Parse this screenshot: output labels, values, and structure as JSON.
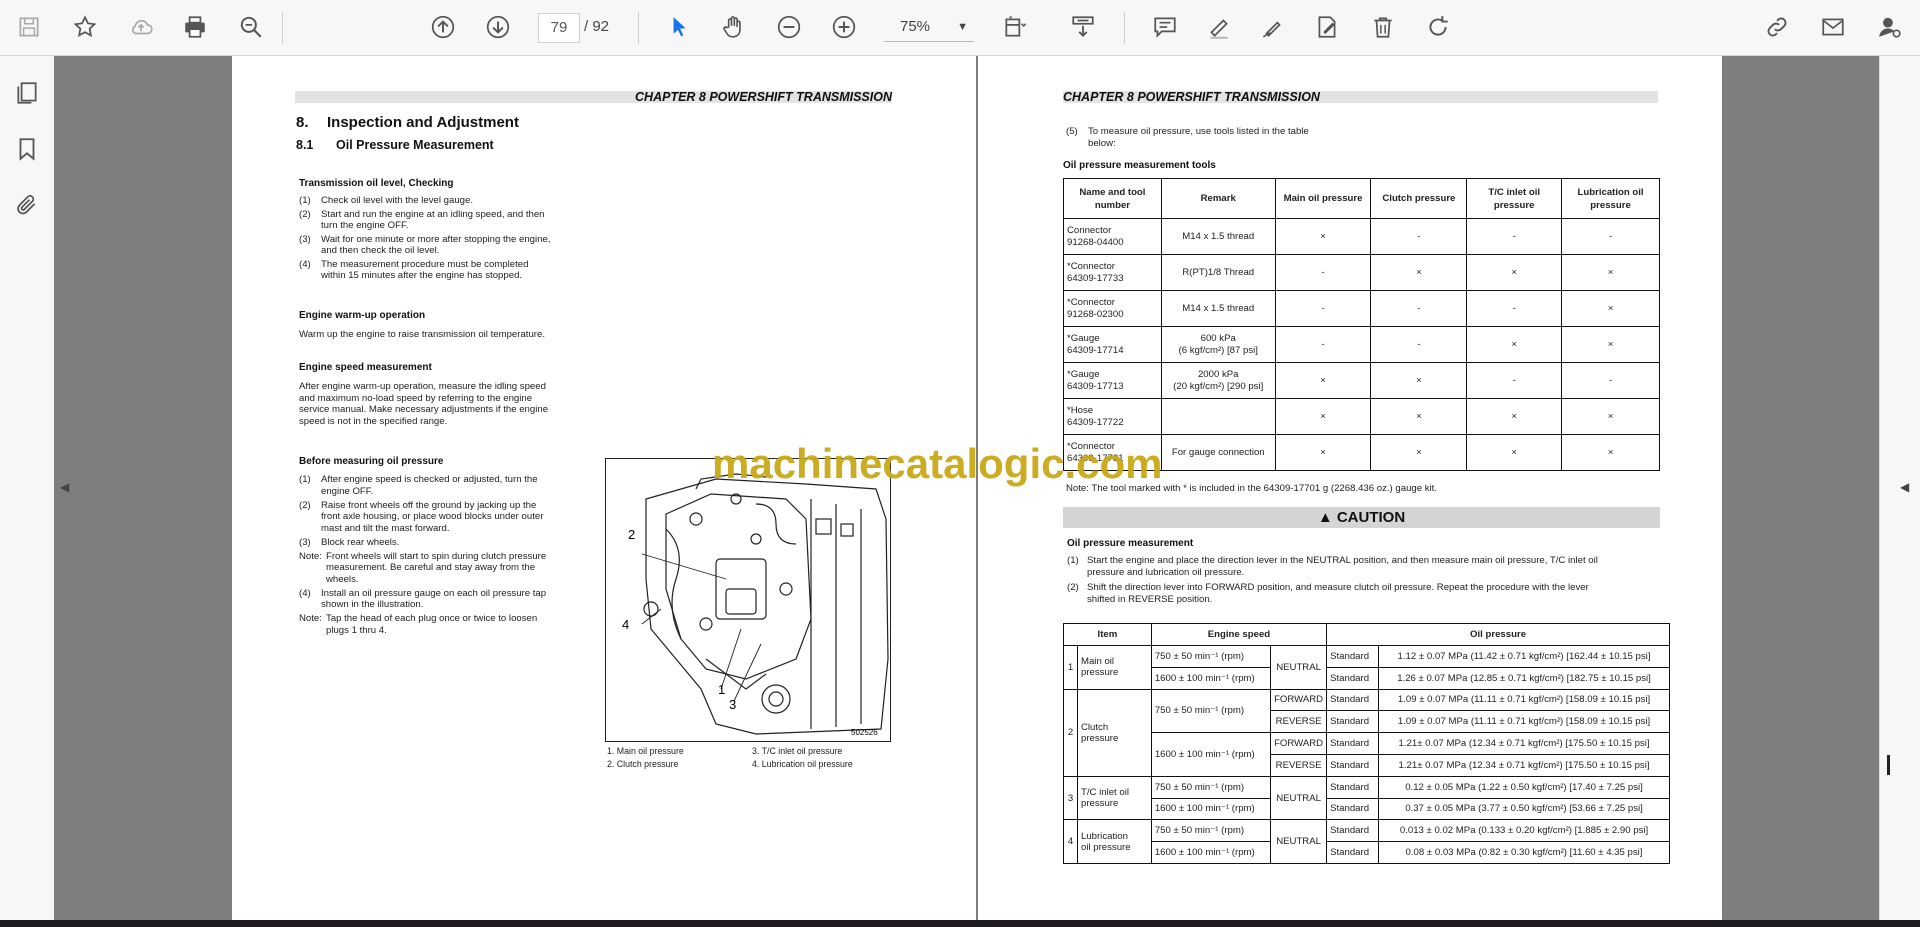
{
  "toolbar": {
    "page_current": "79",
    "page_total": "/  92",
    "zoom": "75%"
  },
  "left_page": {
    "chapter_header": "CHAPTER 8 POWERSHIFT TRANSMISSION",
    "section_number": "8.",
    "section_title": "Inspection and Adjustment",
    "subsection_number": "8.1",
    "subsection_title": "Oil Pressure Measurement",
    "oil_level_title": "Transmission oil level, Checking",
    "oil_level_items": [
      {
        "n": "(1)",
        "lines": [
          "Check oil level with the level gauge."
        ]
      },
      {
        "n": "(2)",
        "lines": [
          "Start and run the engine at an idling speed, and then",
          "turn the engine OFF."
        ]
      },
      {
        "n": "(3)",
        "lines": [
          "Wait for one minute or more after stopping the engine,",
          "and then check the oil level."
        ]
      },
      {
        "n": "(4)",
        "lines": [
          "The measurement procedure must be completed",
          "within 15 minutes after the engine has stopped."
        ]
      }
    ],
    "warmup_title": "Engine warm-up operation",
    "warmup_text": "Warm up the engine to raise transmission oil temperature.",
    "speed_title": "Engine speed measurement",
    "speed_lines": [
      "After engine warm-up operation, measure the idling speed",
      "and maximum no-load speed by referring to the engine",
      "service manual. Make necessary adjustments if the engine",
      "speed is not in the specified range."
    ],
    "before_title": "Before measuring oil pressure",
    "before_items": [
      {
        "n": "(1)",
        "lines": [
          "After engine speed is checked or adjusted, turn the",
          "engine OFF."
        ]
      },
      {
        "n": "(2)",
        "lines": [
          "Raise front wheels off the ground by jacking up the",
          "front axle housing, or place wood blocks under outer",
          "mast and tilt the mast forward."
        ]
      },
      {
        "n": "(3)",
        "lines": [
          "Block rear wheels."
        ]
      },
      {
        "n": "Note:",
        "lines": [
          "Front wheels will start to spin during clutch pressure",
          "measurement. Be careful and stay away from the",
          "wheels."
        ]
      },
      {
        "n": "(4)",
        "lines": [
          "Install an oil pressure gauge on each oil pressure tap",
          "shown in the illustration."
        ]
      },
      {
        "n": "Note:",
        "lines": [
          "Tap the head of each plug once or twice to loosen",
          "plugs 1 thru 4."
        ]
      }
    ],
    "figure_id": "502526",
    "figure_callouts": [
      "1",
      "2",
      "3",
      "4"
    ],
    "figure_captions": [
      "1.  Main oil pressure",
      "2.  Clutch pressure",
      "3.  T/C inlet oil pressure",
      "4.  Lubrication oil pressure"
    ]
  },
  "right_page": {
    "chapter_header": "CHAPTER 8 POWERSHIFT TRANSMISSION",
    "step5_n": "(5)",
    "step5_lines": [
      "To measure oil pressure, use tools listed in the table",
      "below:"
    ],
    "tools_title": "Oil pressure measurement tools",
    "tools_headers": [
      "Name and tool number",
      "Remark",
      "Main oil pressure",
      "Clutch pressure",
      "T/C inlet oil pressure",
      "Lubrication oil pressure"
    ],
    "tools_rows": [
      {
        "name": [
          "Connector",
          "91268-04400"
        ],
        "remark": [
          "M14 x 1.5 thread"
        ],
        "vals": [
          "×",
          "-",
          "-",
          "-"
        ]
      },
      {
        "name": [
          "*Connector",
          "64309-17733"
        ],
        "remark": [
          "R(PT)1/8 Thread"
        ],
        "vals": [
          "-",
          "×",
          "×",
          "×"
        ]
      },
      {
        "name": [
          "*Connector",
          "91268-02300"
        ],
        "remark": [
          "M14 x 1.5 thread"
        ],
        "vals": [
          "-",
          "-",
          "-",
          "×"
        ]
      },
      {
        "name": [
          "*Gauge",
          "64309-17714"
        ],
        "remark": [
          "600 kPa",
          "(6 kgf/cm²) [87 psi]"
        ],
        "vals": [
          "-",
          "-",
          "×",
          "×"
        ]
      },
      {
        "name": [
          "*Gauge",
          "64309-17713"
        ],
        "remark": [
          "2000 kPa",
          "(20 kgf/cm²) [290 psi]"
        ],
        "vals": [
          "×",
          "×",
          "-",
          "-"
        ]
      },
      {
        "name": [
          "*Hose",
          "64309-17722"
        ],
        "remark": [
          ""
        ],
        "vals": [
          "×",
          "×",
          "×",
          "×"
        ]
      },
      {
        "name": [
          "*Connector",
          "64309-17731"
        ],
        "remark": [
          "For gauge connection"
        ],
        "vals": [
          "×",
          "×",
          "×",
          "×"
        ]
      }
    ],
    "tools_note": "Note: The tool marked with * is included in the 64309-17701 g (2268.436 oz.) gauge kit.",
    "caution_label": "CAUTION",
    "measure_title": "Oil pressure measurement",
    "measure_items": [
      {
        "n": "(1)",
        "lines": [
          "Start the engine and place the direction lever in the NEUTRAL position, and then measure main oil pressure, T/C inlet oil",
          "pressure and lubrication oil pressure."
        ]
      },
      {
        "n": "(2)",
        "lines": [
          "Shift the direction lever into FORWARD position, and measure clutch oil pressure. Repeat the procedure with the lever",
          "shifted in REVERSE position."
        ]
      }
    ],
    "spec_headers": [
      "Item",
      "Engine speed",
      "Oil pressure"
    ],
    "spec_groups": [
      {
        "num": "1",
        "item": [
          "Main oil",
          "pressure"
        ],
        "rows": [
          {
            "speed": "750 ± 50 min⁻¹ (rpm)",
            "pos": "NEUTRAL",
            "std": "Standard",
            "val": "1.12 ± 0.07 MPa (11.42 ± 0.71 kgf/cm²) [162.44 ± 10.15 psi]"
          },
          {
            "speed": "1600 ± 100 min⁻¹ (rpm)",
            "pos": "",
            "std": "Standard",
            "val": "1.26 ± 0.07 MPa (12.85 ± 0.71 kgf/cm²) [182.75 ± 10.15 psi]"
          }
        ]
      },
      {
        "num": "2",
        "item": [
          "Clutch",
          "pressure"
        ],
        "rows": [
          {
            "speed": "750 ± 50 min⁻¹ (rpm)",
            "pos": "FORWARD",
            "std": "Standard",
            "val": "1.09 ± 0.07 MPa (11.11 ± 0.71 kgf/cm²) [158.09 ± 10.15 psi]"
          },
          {
            "speed": "",
            "pos": "REVERSE",
            "std": "Standard",
            "val": "1.09 ± 0.07 MPa (11.11 ± 0.71 kgf/cm²) [158.09 ± 10.15 psi]"
          },
          {
            "speed": "1600 ± 100 min⁻¹ (rpm)",
            "pos": "FORWARD",
            "std": "Standard",
            "val": "1.21± 0.07 MPa (12.34 ± 0.71 kgf/cm²) [175.50 ± 10.15 psi]"
          },
          {
            "speed": "",
            "pos": "REVERSE",
            "std": "Standard",
            "val": "1.21± 0.07 MPa (12.34 ± 0.71 kgf/cm²) [175.50 ± 10.15 psi]"
          }
        ]
      },
      {
        "num": "3",
        "item": [
          "T/C inlet oil",
          "pressure"
        ],
        "rows": [
          {
            "speed": "750 ± 50 min⁻¹ (rpm)",
            "pos": "NEUTRAL",
            "std": "Standard",
            "val": "0.12 ± 0.05 MPa (1.22 ± 0.50 kgf/cm²) [17.40 ± 7.25 psi]"
          },
          {
            "speed": "1600 ± 100 min⁻¹ (rpm)",
            "pos": "",
            "std": "Standard",
            "val": "0.37 ± 0.05 MPa (3.77 ± 0.50 kgf/cm²) [53.66 ± 7.25 psi]"
          }
        ]
      },
      {
        "num": "4",
        "item": [
          "Lubrication",
          "oil pressure"
        ],
        "rows": [
          {
            "speed": "750 ± 50 min⁻¹ (rpm)",
            "pos": "NEUTRAL",
            "std": "Standard",
            "val": "0.013 ± 0.02 MPa (0.133 ± 0.20 kgf/cm²) [1.885 ± 2.90 psi]"
          },
          {
            "speed": "1600 ± 100 min⁻¹ (rpm)",
            "pos": "",
            "std": "Standard",
            "val": "0.08 ± 0.03 MPa (0.82 ± 0.30 kgf/cm²) [11.60 ± 4.35 psi]"
          }
        ]
      }
    ]
  },
  "watermark": "machinecatalogic.com",
  "colors": {
    "accent": "#1a73e8",
    "watermark": "#c9a818",
    "viewer_bg": "#7e7e7e"
  }
}
